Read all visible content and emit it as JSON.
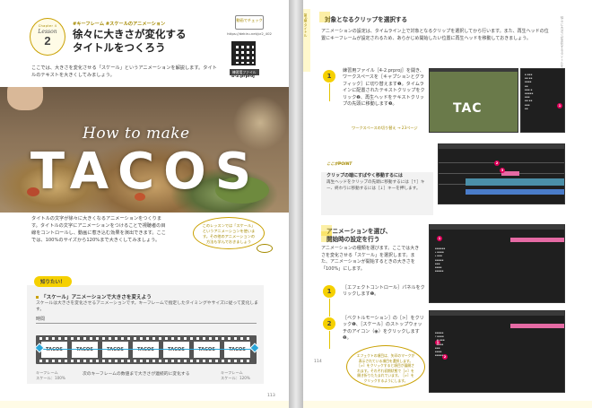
{
  "left": {
    "lesson": {
      "chapter": "Chapter 4",
      "label": "Lesson",
      "number": "2"
    },
    "category": "#キーフレーム #スケールのアニメーション",
    "title_line1": "徐々に大きさが変化する",
    "title_line2": "タイトルをつくろう",
    "intro": "ここでは、大きさを変化させる「スケール」というアニメーションを解説します。タイトルのテキストを大きくしてみましょう。",
    "qr_box": "動画でチェック",
    "qr_url": "https://dekiru.net/pr2_402",
    "practice_label": "練習用ファイル",
    "practice_file": "4-2.prproj",
    "photo_subtitle": "How to make",
    "photo_title": "TACOS",
    "body": "タイトルの文字が徐々に大きくなるアニメーションをつくります。タイトルの文字にアニメーションをつけることで視聴者の目線をコントロールし、動画に惹き込む効果を演出できます。ここでは、100%のサイズから120%まで大きくしてみましょう。",
    "bubble": "このレッスンでは「スケール」というアニメーションを使います。その他のアニメーションの方法も学んでおきましょう",
    "tip": {
      "label": "知りたい！",
      "heading": "「スケール」アニメーションで大きさを変えよう",
      "text": "スケールは大きさを変化させるアニメーションです。キーフレームで指定したタイミングやサイズに従って変化します。",
      "timeline_label": "時間",
      "frames": [
        "TACOS",
        "TACOS",
        "TACOS",
        "TACOS",
        "TACOS",
        "TACOS",
        "TACOS"
      ],
      "kf_left": "キーフレーム\nスケール：100%",
      "kf_right": "キーフレーム\nスケール：120%",
      "caption": "次のキーフレームの数値まで大きさが連続的に変化する"
    },
    "folio": "113"
  },
  "right": {
    "side_tab": "第4章 タイトル",
    "side_lesson": "徐々に大きさが変化するタイトルをつくろう",
    "sec1": {
      "heading": "対象となるクリップを選択する",
      "text": "アニメーションの設定は、タイムライン上で対象となるクリップを選択してから行います。また、再生ヘッドの位置にキーフレームが設定されるため、あらかじめ開始したい位置に再生ヘッドを移動しておきましょう。"
    },
    "step1": {
      "num": "1",
      "text": "練習用ファイル［4-2.prproj］を開き、ワークスペースを［キャプションとグラフィック］に切り替えます❶。タイムラインに配置されたテキストクリップをクリック❷、再生ヘッドをテキストクリップの先頭に移動します❸。",
      "link": "ワークスペースの切り替え → 23ページ",
      "shot_title": "TAC"
    },
    "point": {
      "label": "ここがPOINT",
      "heading": "クリップの端にすばやく移動するには",
      "text": "再生ヘッドをクリップの先頭に移動するには［↑］キー、終わりに移動するには［↓］キーを押します。"
    },
    "sec2": {
      "heading_line1": "アニメーションを選び、",
      "heading_line2": "開始時の設定を行う",
      "text": "アニメーションの種類を選びます。ここでは大きさを変化させる「スケール」を選択します。また、アニメーションが開始するときの大きさを「100%」にします。"
    },
    "step2": {
      "num": "1",
      "text": "［エフェクトコントロール］パネルをクリックします❶。"
    },
    "step3": {
      "num": "2",
      "text": "［ベクトルモーション］の［>］をクリック❶、［スケール］のストップウォッチのアイコン（◉）をクリックします❷。"
    },
    "note": "エフェクトの項目は、矢印のマークが表示されている項目を選択します。［>］をクリックすると項目が展開されます。それぞれ初期状態で［>］を開き折りたたまれています。［>］をクリックするようにします。",
    "folio": "114"
  },
  "colors": {
    "accent": "#f5d000",
    "accent_text": "#a58a00",
    "keyframe": "#2aa6d9",
    "marker": "#e0005a"
  }
}
